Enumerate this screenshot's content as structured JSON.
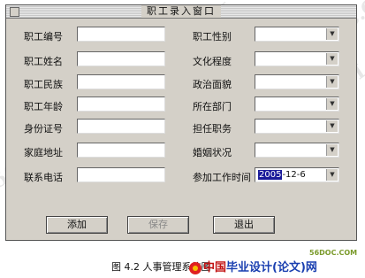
{
  "window": {
    "title": "职工录入窗口"
  },
  "left_fields": [
    {
      "label": "职工编号",
      "value": ""
    },
    {
      "label": "职工姓名",
      "value": ""
    },
    {
      "label": "职工民族",
      "value": ""
    },
    {
      "label": "职工年龄",
      "value": ""
    },
    {
      "label": "身份证号",
      "value": ""
    },
    {
      "label": "家庭地址",
      "value": ""
    },
    {
      "label": "联系电话",
      "value": ""
    }
  ],
  "right_fields": [
    {
      "label": "职工性别",
      "value": ""
    },
    {
      "label": "文化程度",
      "value": ""
    },
    {
      "label": "政治面貌",
      "value": ""
    },
    {
      "label": "所在部门",
      "value": ""
    },
    {
      "label": "担任职务",
      "value": ""
    },
    {
      "label": "婚姻状况",
      "value": ""
    }
  ],
  "date_field": {
    "label": "参加工作时间",
    "year": "2005",
    "rest": "-12-6"
  },
  "buttons": {
    "add": "添加",
    "save": "保存",
    "exit": "退出"
  },
  "caption": {
    "text": "图 4.2 人事管理系统图",
    "logo_china": "中国",
    "logo_rest": "毕业设计(论文)网",
    "site": "56DOC.COM"
  },
  "watermarks": [
    "56DOC.COM",
    "56DOC.COM",
    "56DOC.COM",
    "56DOC.COM",
    "56DOC.COM"
  ]
}
